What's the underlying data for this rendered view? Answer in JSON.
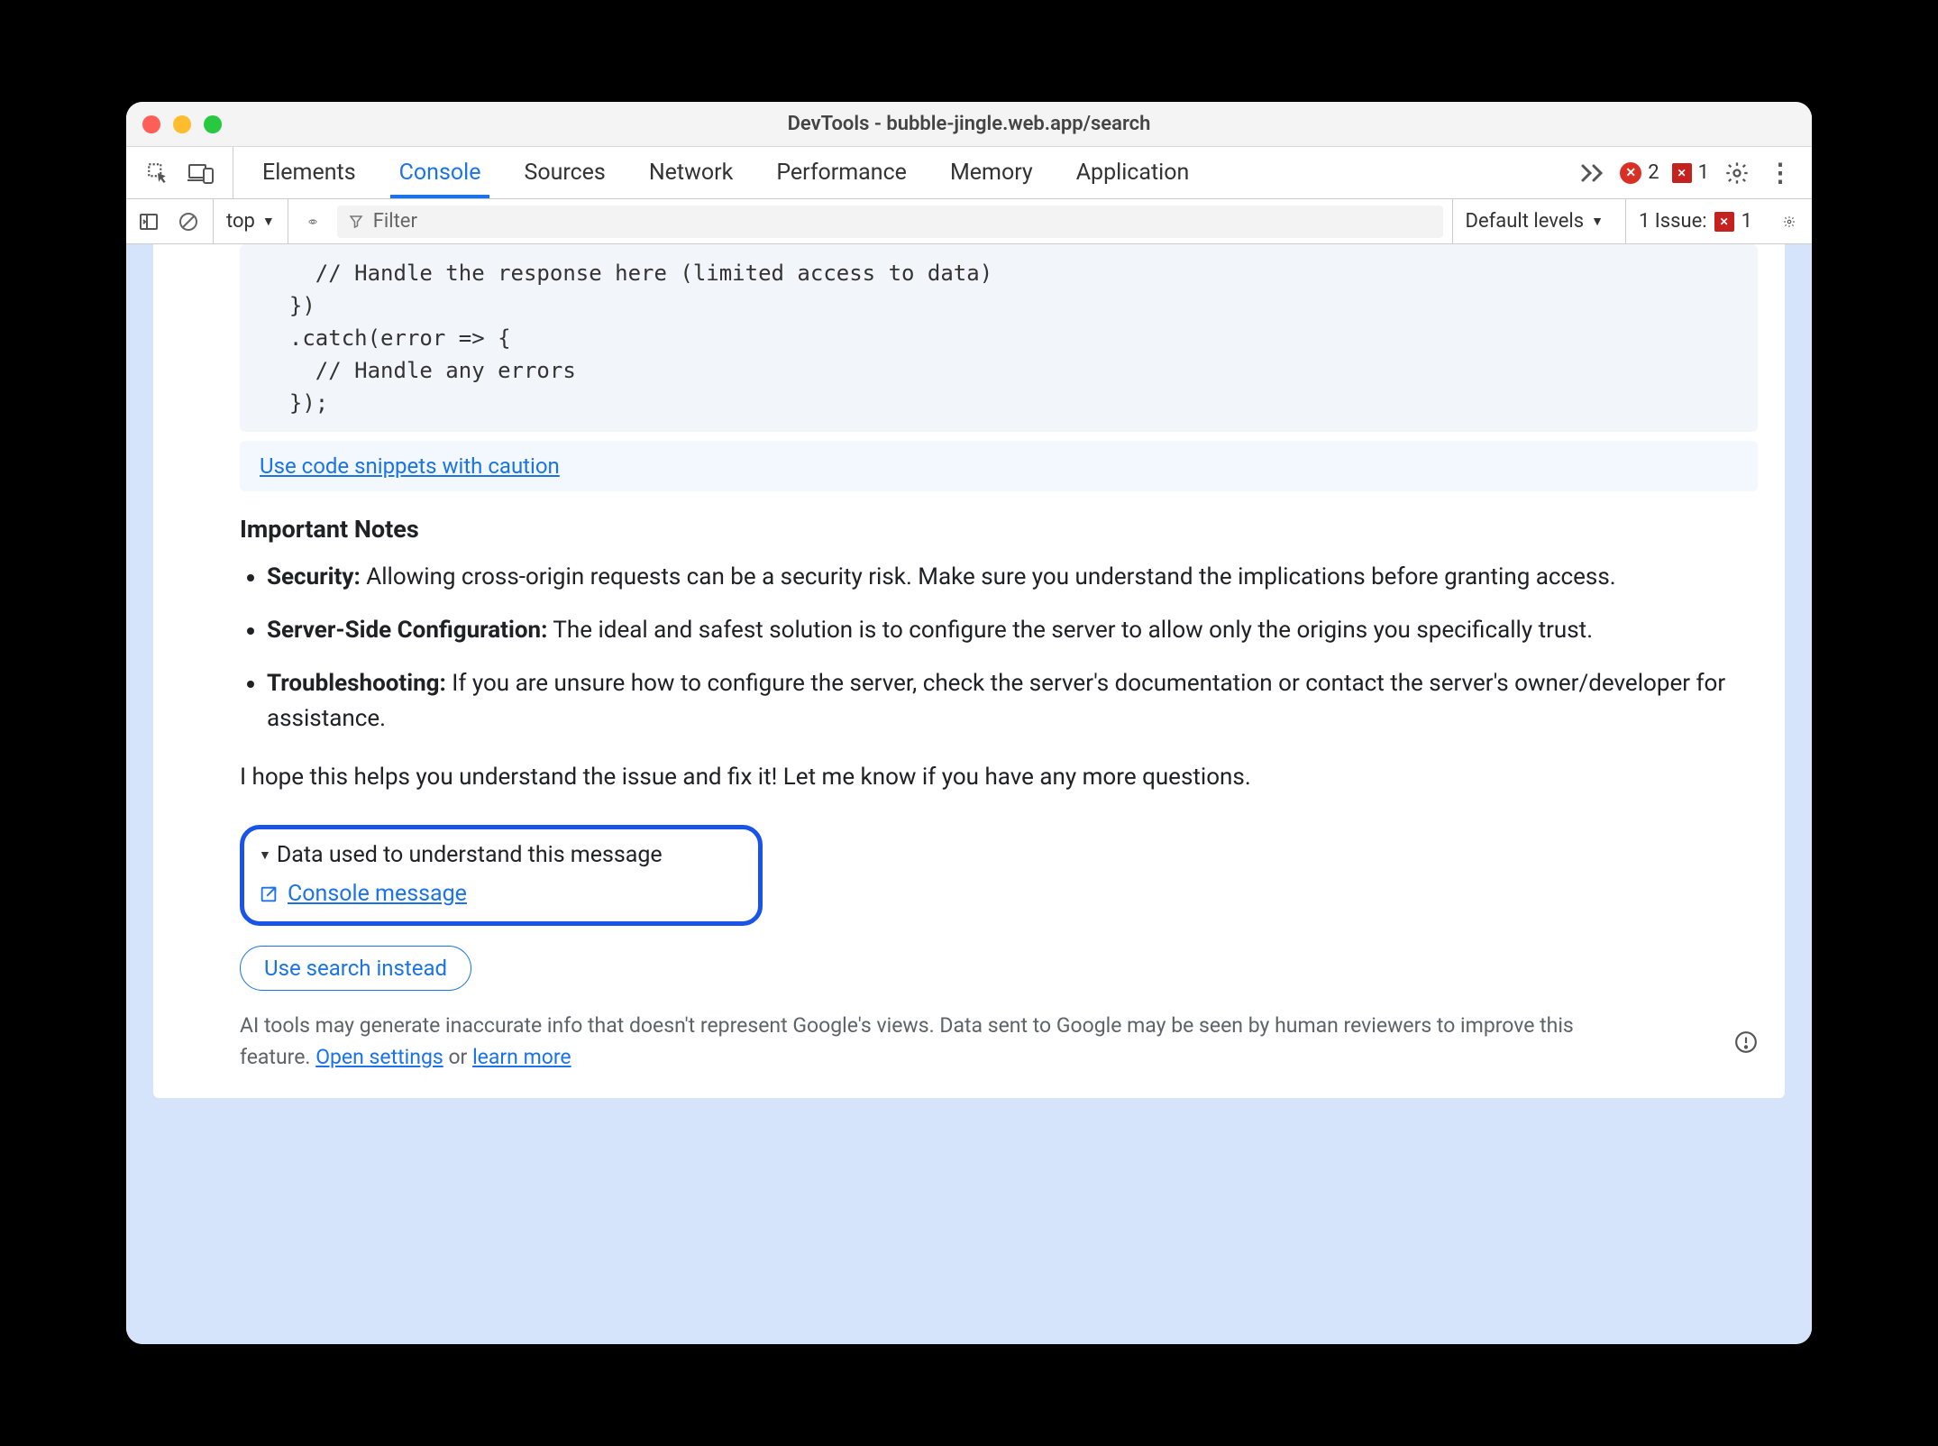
{
  "title": "DevTools - bubble-jingle.web.app/search",
  "tabs": [
    "Elements",
    "Console",
    "Sources",
    "Network",
    "Performance",
    "Memory",
    "Application"
  ],
  "activeTab": "Console",
  "errorCount": "2",
  "issueCount": "1",
  "context": "top",
  "filterPlaceholder": "Filter",
  "levelsLabel": "Default levels",
  "issuesLabel": "1 Issue:",
  "issuesBadgeCount": "1",
  "code": "    // Handle the response here (limited access to data)\n  })\n  .catch(error => {\n    // Handle any errors\n  });",
  "cautionLink": "Use code snippets with caution",
  "notesHeading": "Important Notes",
  "notes": [
    {
      "b": "Security:",
      "t": " Allowing cross-origin requests can be a security risk. Make sure you understand the implications before granting access."
    },
    {
      "b": "Server-Side Configuration:",
      "t": " The ideal and safest solution is to configure the server to allow only the origins you specifically trust."
    },
    {
      "b": "Troubleshooting:",
      "t": " If you are unsure how to configure the server, check the server's documentation or contact the server's owner/developer for assistance."
    }
  ],
  "closing": "I hope this helps you understand the issue and fix it! Let me know if you have any more questions.",
  "dataUsedHeader": "Data used to understand this message",
  "consoleMessageLink": "Console message",
  "searchInstead": "Use search instead",
  "disclaimerA": "AI tools may generate inaccurate info that doesn't represent Google's views. Data sent to Google may be seen by human reviewers to improve this feature. ",
  "openSettings": "Open settings",
  "or": " or ",
  "learnMore": "learn more"
}
